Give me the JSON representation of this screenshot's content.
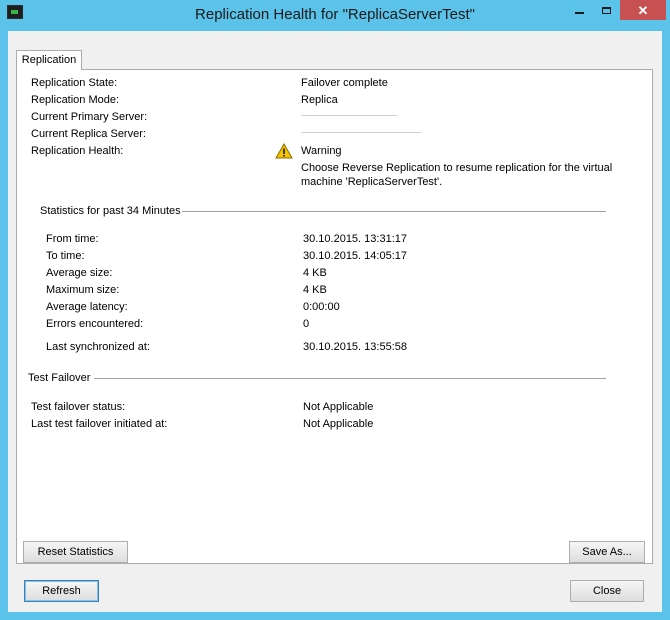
{
  "window": {
    "title": "Replication Health for \"ReplicaServerTest\""
  },
  "tab": {
    "label": "Replication"
  },
  "summary": {
    "rows": [
      {
        "label": "Replication State:",
        "value": "Failover complete"
      },
      {
        "label": "Replication Mode:",
        "value": "Replica"
      },
      {
        "label": "Current Primary Server:",
        "value": ""
      },
      {
        "label": "Current Replica Server:",
        "value": ""
      },
      {
        "label": "Replication Health:",
        "value": "Warning"
      }
    ],
    "health_message_line1": "Choose Reverse Replication to resume replication for the virtual",
    "health_message_line2": "machine 'ReplicaServerTest'.",
    "health_icon": "warning-icon"
  },
  "statistics": {
    "heading": "Statistics for past 34 Minutes",
    "rows": [
      {
        "label": "From time:",
        "value": "30.10.2015. 13:31:17"
      },
      {
        "label": "To time:",
        "value": "30.10.2015. 14:05:17"
      },
      {
        "label": "Average size:",
        "value": "4 KB"
      },
      {
        "label": "Maximum size:",
        "value": "4 KB"
      },
      {
        "label": "Average latency:",
        "value": "0:00:00"
      },
      {
        "label": "Errors encountered:",
        "value": "0"
      },
      {
        "label": "Last synchronized at:",
        "value": "30.10.2015. 13:55:58"
      }
    ]
  },
  "test_failover": {
    "heading": "Test Failover",
    "rows": [
      {
        "label": "Test failover status:",
        "value": "Not Applicable"
      },
      {
        "label": "Last test failover initiated at:",
        "value": "Not Applicable"
      }
    ]
  },
  "buttons": {
    "reset_statistics": "Reset Statistics",
    "save_as": "Save As...",
    "refresh": "Refresh",
    "close": "Close"
  },
  "colors": {
    "title_bar": "#5bc3ea",
    "close_button": "#c75050",
    "warning": "#f5c400"
  }
}
